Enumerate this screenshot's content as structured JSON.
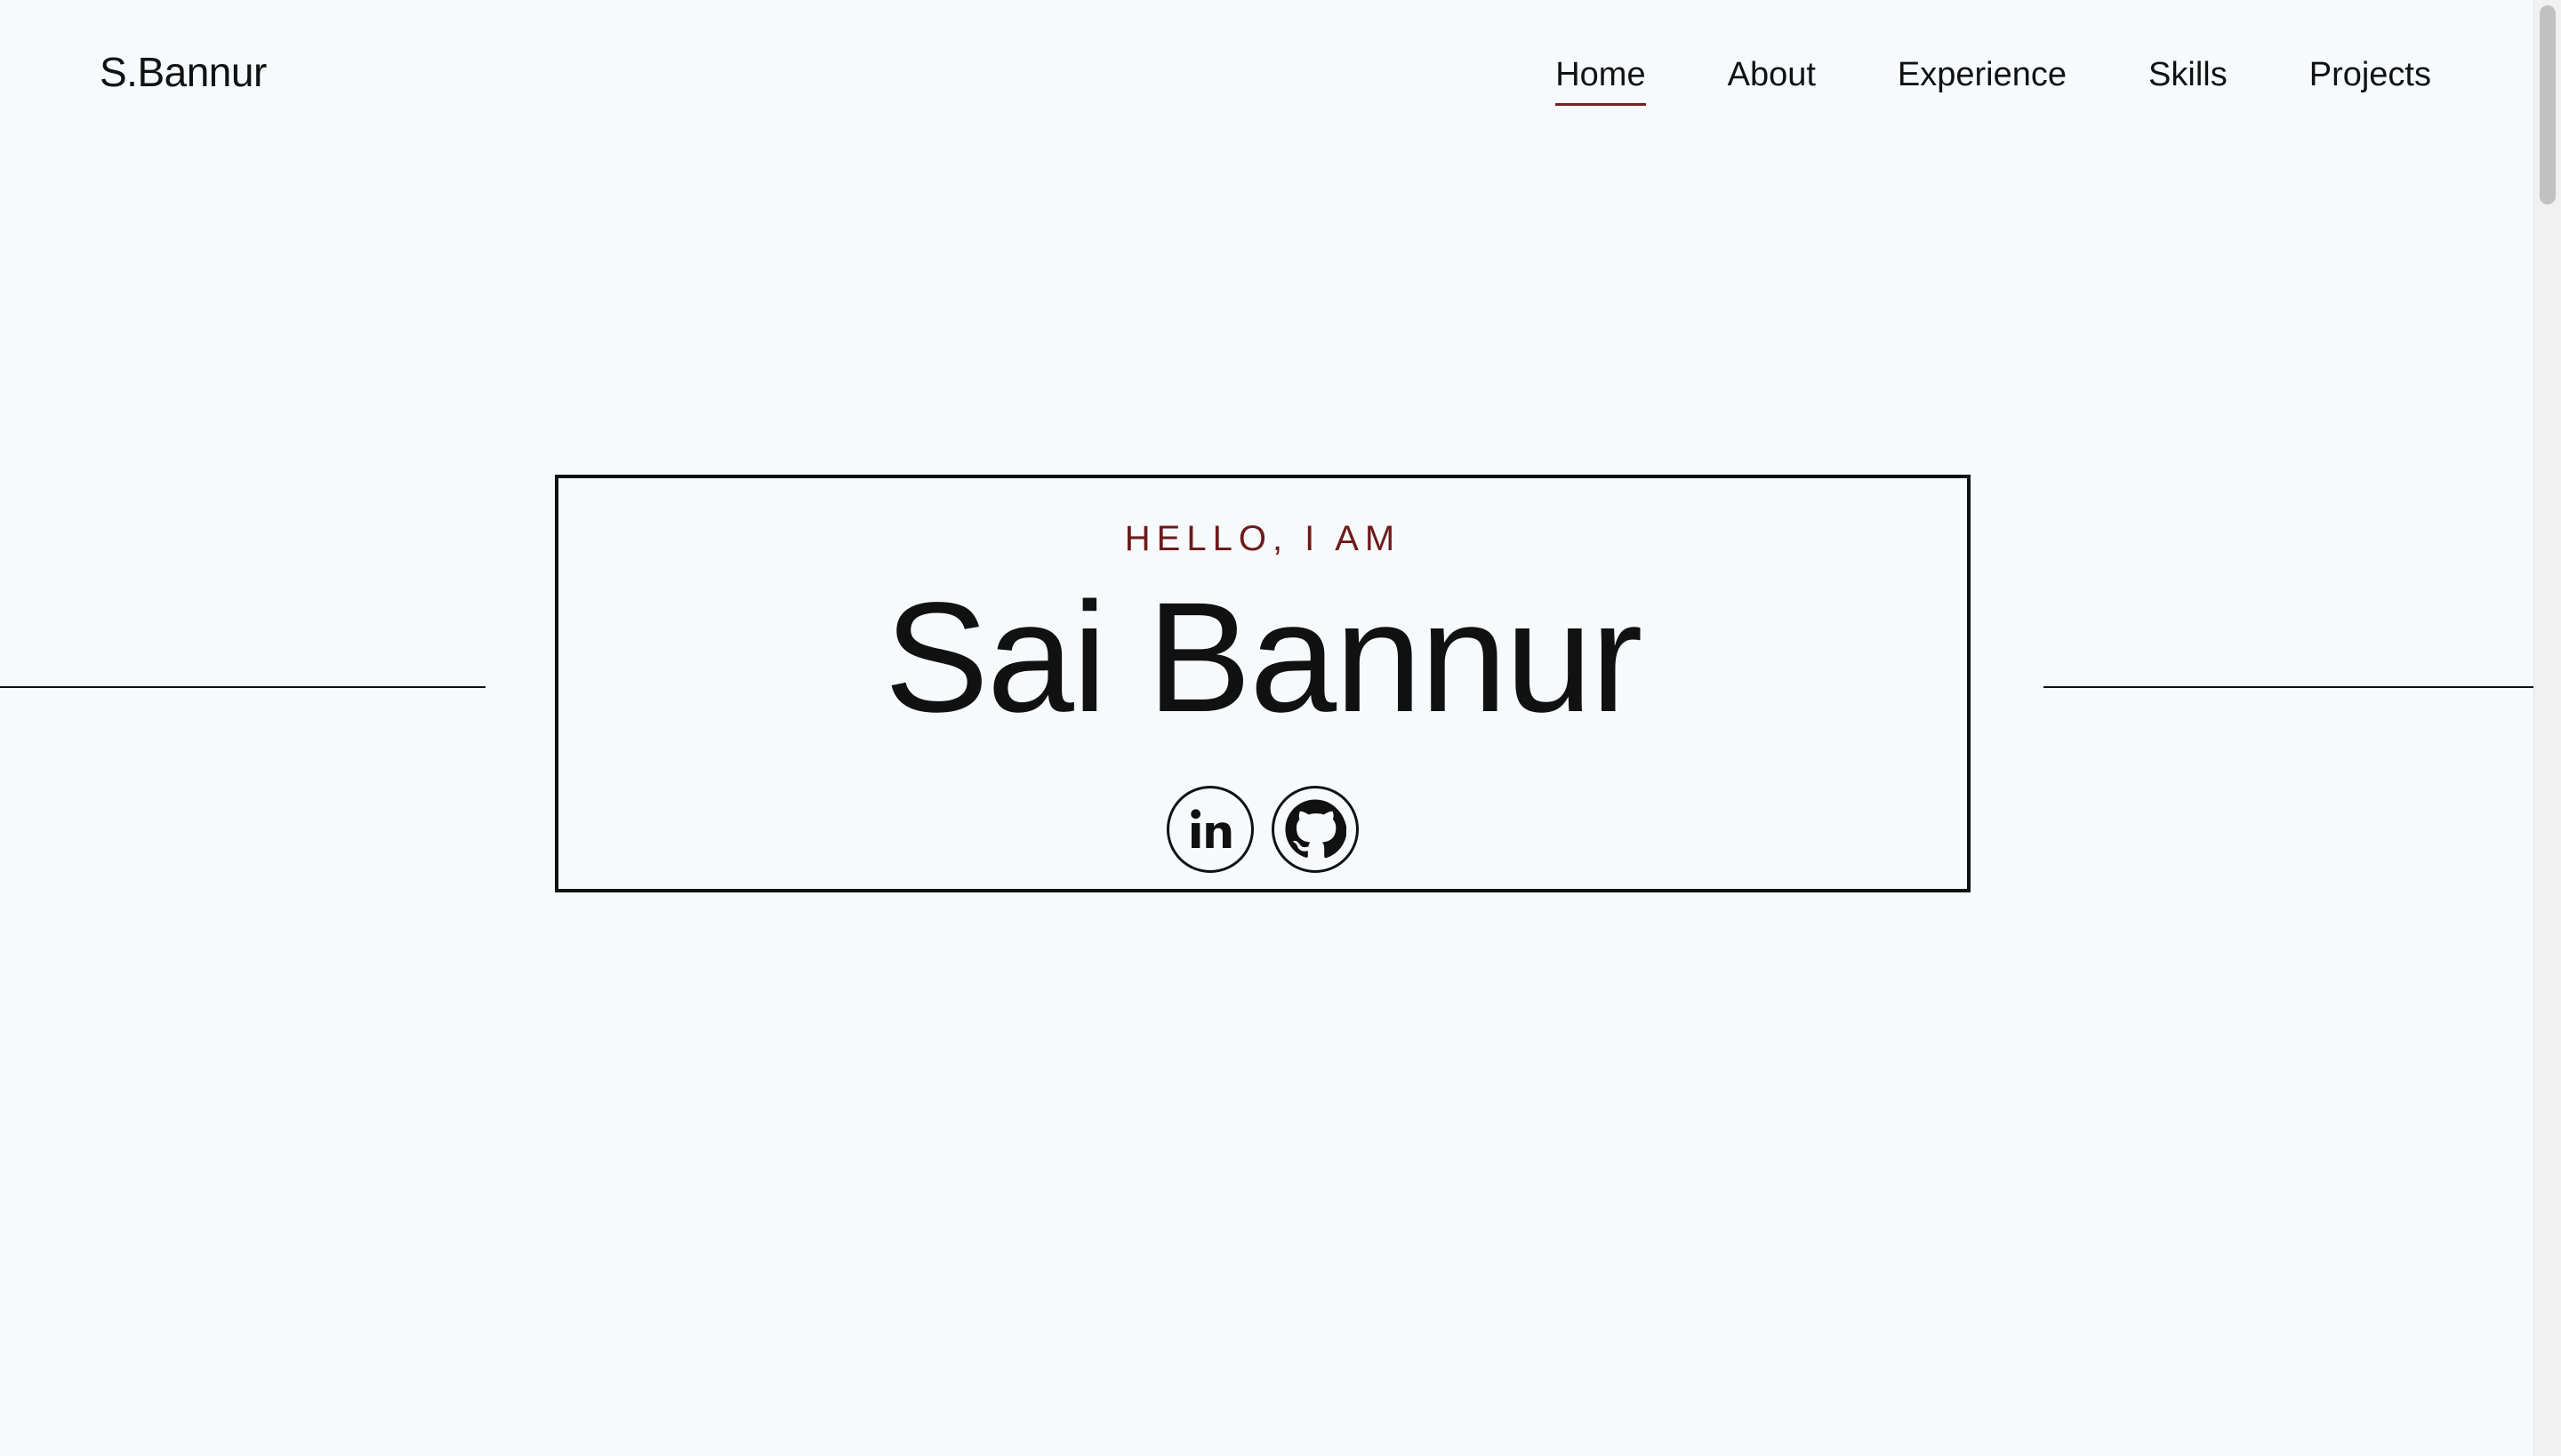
{
  "header": {
    "brand": "S.Bannur",
    "nav": [
      {
        "label": "Home",
        "active": true
      },
      {
        "label": "About",
        "active": false
      },
      {
        "label": "Experience",
        "active": false
      },
      {
        "label": "Skills",
        "active": false
      },
      {
        "label": "Projects",
        "active": false
      }
    ]
  },
  "hero": {
    "eyebrow": "HELLO, I AM",
    "name": "Sai Bannur",
    "socials": [
      {
        "icon": "linkedin-icon"
      },
      {
        "icon": "github-icon"
      }
    ]
  },
  "colors": {
    "background": "#f6fafd",
    "accent": "#7a1e1e",
    "text": "#111111"
  }
}
